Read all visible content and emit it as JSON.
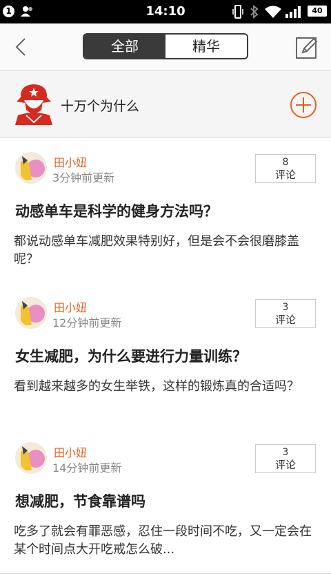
{
  "status_bar": {
    "notification_count": "1",
    "time": "14:10",
    "battery": "40",
    "icons": [
      "person-icon",
      "vibrate-icon",
      "bluetooth-icon",
      "wifi-icon",
      "signal-icon",
      "battery-icon"
    ]
  },
  "header": {
    "tabs": [
      {
        "label": "全部",
        "selected": true
      },
      {
        "label": "精华",
        "selected": false
      }
    ],
    "icons": [
      "back-icon",
      "edit-icon"
    ]
  },
  "topic": {
    "name": "十万个为什么",
    "accent": "#e85d1e"
  },
  "posts": [
    {
      "author": "田小妞",
      "time": "3分钟前更新",
      "comment_count": "8",
      "comment_label": "评论",
      "title": "动感单车是科学的健身方法吗？",
      "excerpt": "都说动感单车减肥效果特别好，但是会不会很磨膝盖呢？"
    },
    {
      "author": "田小妞",
      "time": "12分钟前更新",
      "comment_count": "3",
      "comment_label": "评论",
      "title": "女生减肥，为什么要进行力量训练？",
      "excerpt": "看到越来越多的女生举铁，这样的锻炼真的合适吗？"
    },
    {
      "author": "田小妞",
      "time": "14分钟前更新",
      "comment_count": "3",
      "comment_label": "评论",
      "title": "想减肥，节食靠谱吗",
      "excerpt": "吃多了就会有罪恶感，忍住一段时间不吃，又一定会在某个时间点大开吃戒怎么破..."
    }
  ]
}
